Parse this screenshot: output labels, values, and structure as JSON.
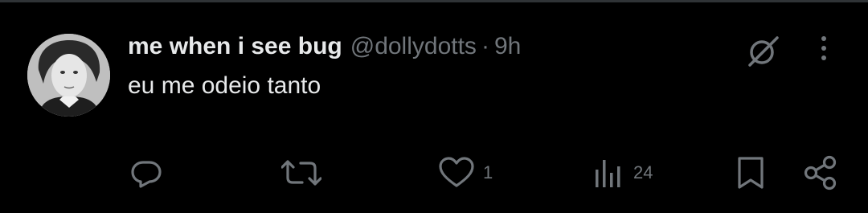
{
  "tweet": {
    "display_name": "me when i see bug",
    "handle": "@dollydotts",
    "separator": "·",
    "timestamp": "9h",
    "text": "eu me odeio tanto"
  },
  "actions": {
    "reply": {
      "icon": "reply-icon",
      "count": ""
    },
    "retweet": {
      "icon": "retweet-icon",
      "count": ""
    },
    "like": {
      "icon": "heart-icon",
      "count": "1"
    },
    "views": {
      "icon": "views-icon",
      "count": "24"
    },
    "bookmark": {
      "icon": "bookmark-icon"
    },
    "share": {
      "icon": "share-icon"
    }
  },
  "colors": {
    "background": "#000000",
    "primary_text": "#e7e9ea",
    "secondary_text": "#71767b",
    "divider": "#2f3336"
  }
}
